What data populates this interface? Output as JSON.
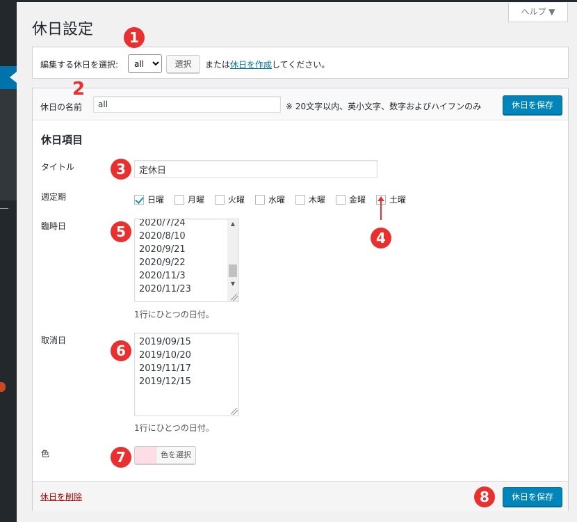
{
  "help": {
    "label": "ヘルプ ▼"
  },
  "page": {
    "title": "休日設定"
  },
  "select_bar": {
    "label": "編集する休日を選択:",
    "selected": "all",
    "select_button": "選択",
    "text_or": "または",
    "create_link": "休日を作成",
    "text_suffix": "してください。"
  },
  "name_row": {
    "label": "休日の名前",
    "value": "all",
    "hint": "※ 20文字以内、英小文字、数字およびハイフンのみ",
    "save_button": "休日を保存"
  },
  "items": {
    "heading": "休日項目",
    "title_label": "タイトル",
    "title_value": "定休日",
    "weekly_label": "週定期",
    "days": [
      {
        "label": "日曜",
        "checked": true
      },
      {
        "label": "月曜",
        "checked": false
      },
      {
        "label": "火曜",
        "checked": false
      },
      {
        "label": "水曜",
        "checked": false
      },
      {
        "label": "木曜",
        "checked": false
      },
      {
        "label": "金曜",
        "checked": false
      },
      {
        "label": "土曜",
        "checked": false
      }
    ],
    "temp_label": "臨時日",
    "temp_dates": [
      "2020/7/24",
      "2020/8/10",
      "2020/9/21",
      "2020/9/22",
      "2020/11/3",
      "2020/11/23"
    ],
    "temp_note": "1行にひとつの日付。",
    "cancel_label": "取消日",
    "cancel_dates": [
      "2019/09/15",
      "2019/10/20",
      "2019/11/17",
      "2019/12/15"
    ],
    "cancel_note": "1行にひとつの日付。",
    "color_label": "色",
    "color_button": "色を選択",
    "color_value": "#fddde6"
  },
  "footer": {
    "delete_link": "休日を削除",
    "save_button": "休日を保存"
  },
  "markers": [
    "1",
    "2",
    "3",
    "4",
    "5",
    "6",
    "7",
    "8"
  ],
  "colors": {
    "primary": "#0085ba",
    "marker": "#e8312f",
    "sidebar": "#23282d",
    "link": "#0073aa",
    "delete": "#aa0000"
  }
}
